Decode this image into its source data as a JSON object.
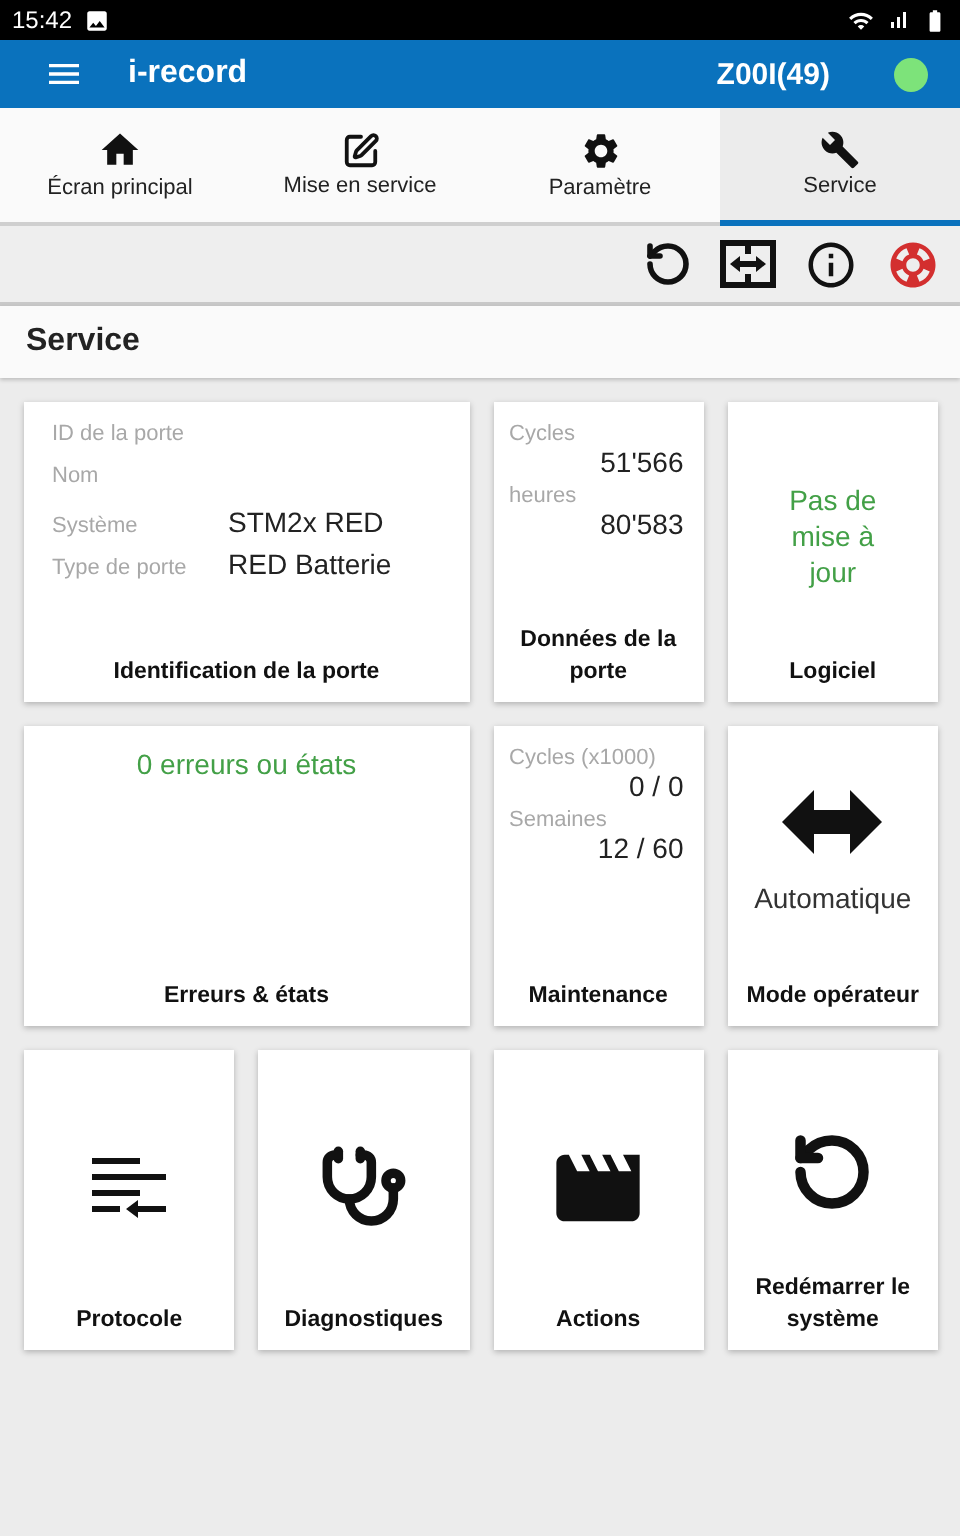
{
  "status_bar": {
    "time": "15:42"
  },
  "app_bar": {
    "title": "i-record",
    "device": "Z00I(49)",
    "connected": true
  },
  "tabs": [
    {
      "label": "Écran principal",
      "selected": false
    },
    {
      "label": "Mise en service",
      "selected": false
    },
    {
      "label": "Paramètre",
      "selected": false
    },
    {
      "label": "Service",
      "selected": true
    }
  ],
  "section_title": "Service",
  "cards": [
    {
      "kind": "info",
      "title": "Identification de la porte",
      "rows": [
        {
          "label": "ID de la porte"
        },
        {
          "label": "Nom"
        },
        {
          "label": "Système",
          "value": "STM2x RED"
        },
        {
          "label": "Type de porte",
          "value": "RED Batterie"
        }
      ]
    },
    {
      "kind": "counters",
      "title": "Données de la porte",
      "rows": [
        {
          "label": "Cycles",
          "value": "51'566"
        },
        {
          "label": "heures",
          "value": "80'583"
        }
      ]
    },
    {
      "kind": "message",
      "title": "Logiciel",
      "message": "Pas de mise à jour"
    },
    {
      "kind": "errors",
      "title": "Erreurs & états",
      "message": "0 erreurs ou états"
    },
    {
      "kind": "counters",
      "title": "Maintenance",
      "rows": [
        {
          "label": "Cycles (x1000)",
          "value": "0 / 0"
        },
        {
          "label": "Semaines",
          "value": "12 / 60"
        }
      ]
    },
    {
      "kind": "mode",
      "title": "Mode opérateur",
      "value": "Automatique"
    },
    {
      "kind": "action",
      "title": "Protocole"
    },
    {
      "kind": "action",
      "title": "Diagnostiques"
    },
    {
      "kind": "action",
      "title": "Actions"
    },
    {
      "kind": "action",
      "title": "Redémarrer le système"
    }
  ]
}
